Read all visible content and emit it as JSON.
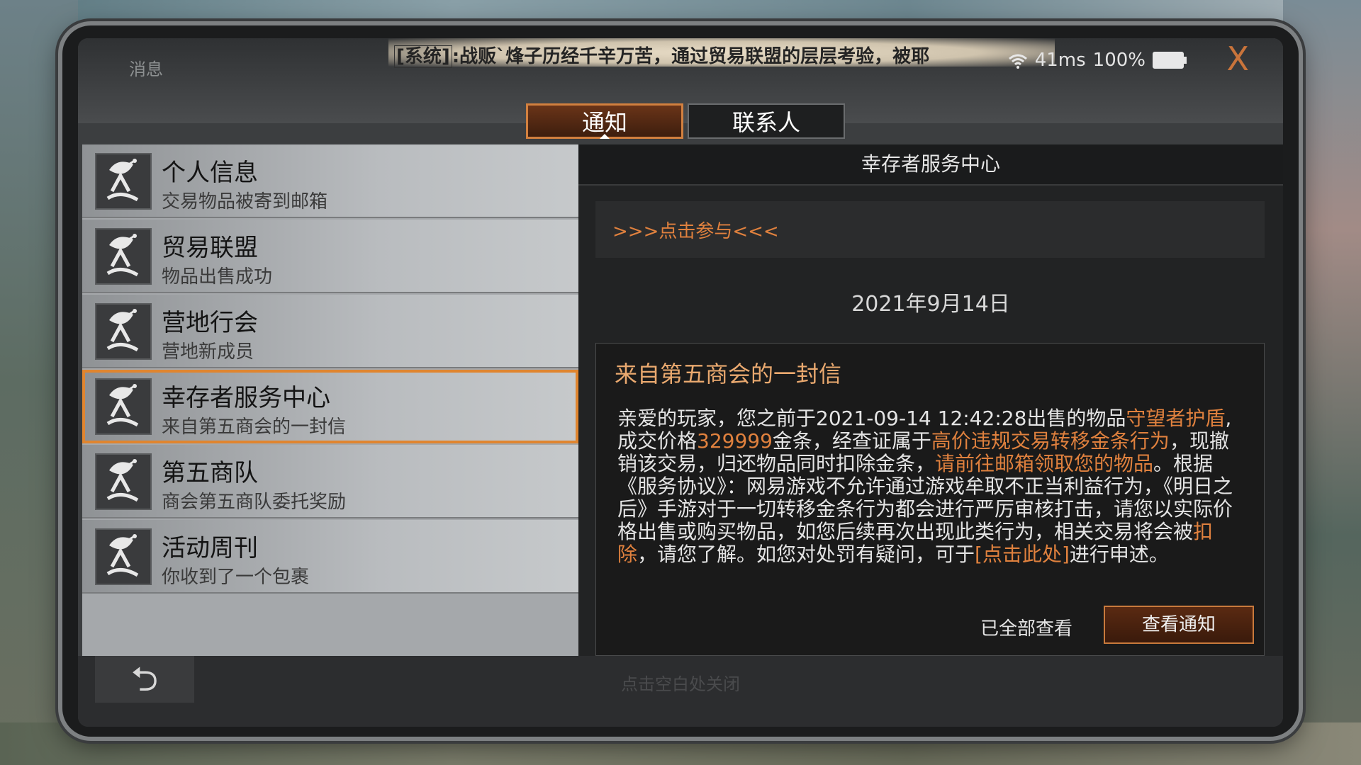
{
  "topbar": {
    "title": "消息",
    "marquee_tag": "[系统]",
    "marquee_text": ":战贩`烽子历经千辛万苦，通过贸易联盟的层层考验，被耶",
    "ping": "41ms",
    "battery": "100%",
    "close_label": "X"
  },
  "tabs": [
    {
      "label": "通知",
      "active": true
    },
    {
      "label": "联系人",
      "active": false
    }
  ],
  "list": [
    {
      "title": "个人信息",
      "subtitle": "交易物品被寄到邮箱"
    },
    {
      "title": "贸易联盟",
      "subtitle": "物品出售成功"
    },
    {
      "title": "营地行会",
      "subtitle": "营地新成员"
    },
    {
      "title": "幸存者服务中心",
      "subtitle": "来自第五商会的一封信"
    },
    {
      "title": "第五商队",
      "subtitle": "商会第五商队委托奖励"
    },
    {
      "title": "活动周刊",
      "subtitle": "你收到了一个包裹"
    }
  ],
  "detail": {
    "header": "幸存者服务中心",
    "join_link": ">>>点击参与<<<",
    "date": "2021年9月14日",
    "letter_title": "来自第五商会的一封信",
    "body": {
      "p1": "亲爱的玩家，您之前于2021-09-14 12:42:28出售的物品",
      "h1": "守望者护盾",
      "p2": ",成交价格",
      "h2": "329999",
      "p3": "金条，经查证属于",
      "h3": "高价违规交易转移金条行为",
      "p4": "，现撤销该交易，归还物品同时扣除金条，",
      "h4": "请前往邮箱领取您的物品",
      "p5": "。根据《服务协议》：网易游戏不允许通过游戏牟取不正当利益行为，《明日之后》手游对于一切转移金条行为都会进行严厉审核打击，请您以实际价格出售或购买物品，如您后续再次出现此类行为，相关交易将会被",
      "h5": "扣除",
      "p6": "，请您了解。如您对处罚有疑问，可于",
      "h6": "[点击此处]",
      "p7": "进行申述。"
    },
    "read_all": "已全部查看",
    "view_button": "查看通知"
  },
  "bottom": {
    "back_label": "⮌",
    "close_hint": "点击空白处关闭"
  },
  "colors": {
    "accent": "#e0813e",
    "selected_border": "#e0852f"
  }
}
